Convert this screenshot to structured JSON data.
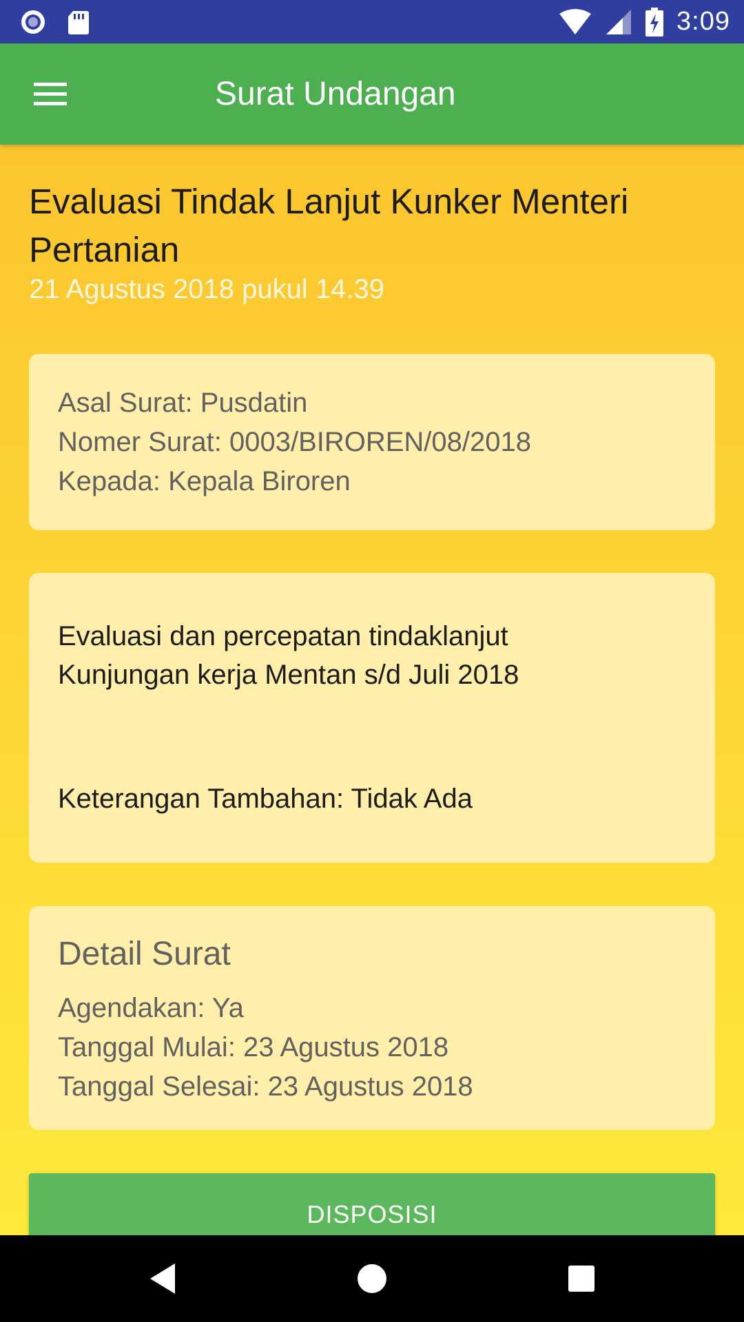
{
  "status_bar": {
    "time": "3:09",
    "icons": [
      "record-icon",
      "sd-card-icon",
      "wifi-icon",
      "signal-icon",
      "battery-charging-icon"
    ]
  },
  "app_bar": {
    "title": "Surat Undangan",
    "menu_icon": "menu-icon"
  },
  "letter": {
    "title": "Evaluasi Tindak Lanjut Kunker Menteri Pertanian",
    "date": "21 Agustus 2018 pukul 14.39"
  },
  "info_card": {
    "asal": "Asal Surat: Pusdatin",
    "nomer": "Nomer Surat: 0003/BIROREN/08/2018",
    "kepada": "Kepala Biroren",
    "kepada_label": "Kepada: Kepala Biroren"
  },
  "desc_card": {
    "line1": "Evaluasi dan percepatan tindaklanjut",
    "line2": "Kunjungan kerja Mentan s/d Juli 2018",
    "extra": "Keterangan Tambahan: Tidak Ada"
  },
  "detail_card": {
    "title": "Detail Surat",
    "agendakan": "Agendakan: Ya",
    "mulai": "Tanggal Mulai: 23 Agustus 2018",
    "selesai": "Tanggal Selesai: 23 Agustus 2018"
  },
  "actions": {
    "disposisi_label": "DISPOSISI"
  },
  "nav_bar": {
    "icons": [
      "back-icon",
      "home-icon",
      "recents-icon"
    ]
  },
  "colors": {
    "status_bar": "#303f9f",
    "app_bar": "#4caf50",
    "background_top": "#fbc02d",
    "background_bottom": "#ffeb3b",
    "card": "#ffefaa",
    "button": "#5cb85c"
  }
}
